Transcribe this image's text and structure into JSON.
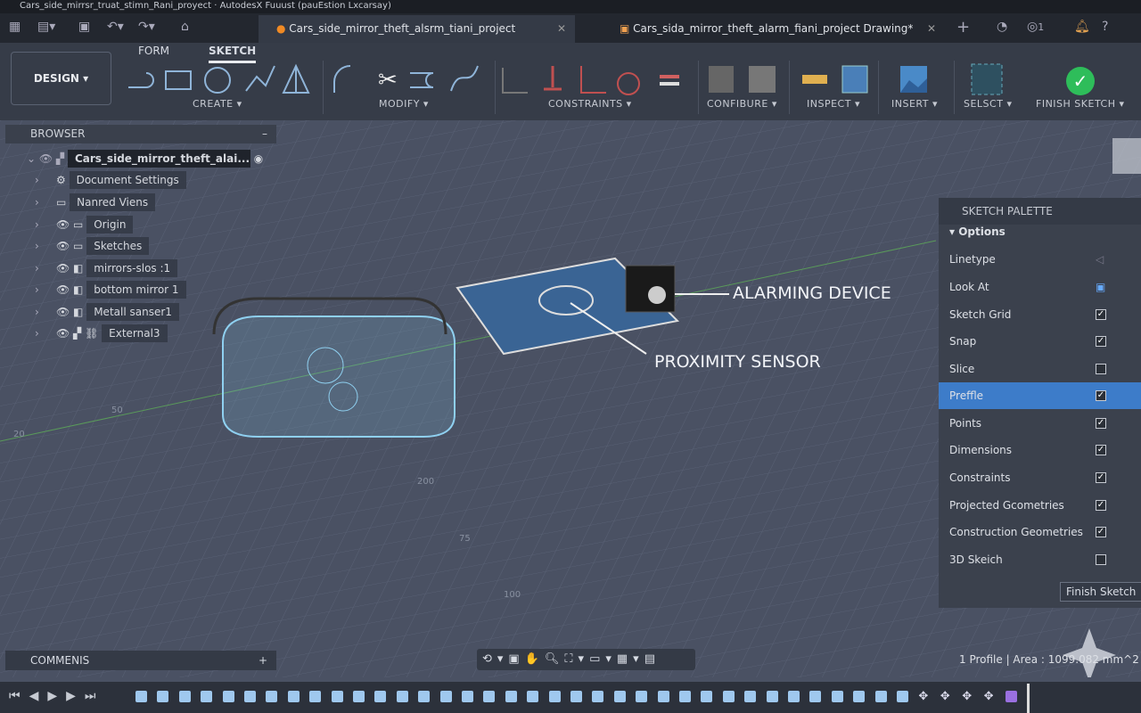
{
  "window": {
    "title": "Cars_side_mirrsr_truat_stimn_Rani_proyect · AutodesX Fuuust (pauEstion Lxcarsay)"
  },
  "tabs": [
    {
      "label": "Cars_side_mirror_theft_alsrm_tiani_project"
    },
    {
      "label": "Cars_sida_mirror_theft_alarm_fiani_project Drawing*"
    }
  ],
  "header_icons": {
    "notifications_count": "1"
  },
  "toolbar": {
    "workspace": "DESIGN",
    "tabs": [
      "FORM",
      "SKETCH"
    ],
    "active_tab": "SKETCH",
    "groups": [
      "CREATE",
      "MODIFY",
      "CONSTRAINTS",
      "CONFIBURE",
      "INSPECT",
      "INSERT",
      "SELSCT",
      "FINISH SKETCH"
    ]
  },
  "browser": {
    "title": "BROWSER",
    "items": [
      {
        "label": "Cars_side_mirror_theft_alai...",
        "icon": "component-icon"
      },
      {
        "label": "Document Settings",
        "icon": "gear-icon"
      },
      {
        "label": "Nanred Viens",
        "icon": "folder-icon"
      },
      {
        "label": "Origin",
        "icon": "folder-icon"
      },
      {
        "label": "Sketches",
        "icon": "folder-icon"
      },
      {
        "label": "mirrors-slos :1",
        "icon": "body-icon"
      },
      {
        "label": "bottom mirror 1",
        "icon": "body-icon"
      },
      {
        "label": "Metall sanser1",
        "icon": "body-icon"
      },
      {
        "label": "External3",
        "icon": "link-icon"
      }
    ]
  },
  "viewport": {
    "callouts": [
      "ALARMING DEVICE",
      "PROXIMITY SENSOR"
    ],
    "grid_labels": [
      "20",
      "50",
      "200",
      "75",
      "100"
    ]
  },
  "palette": {
    "title": "SKETCH PALETTE",
    "section": "Options",
    "rows": [
      {
        "label": "Linetype",
        "type": "icon"
      },
      {
        "label": "Look At",
        "type": "icon"
      },
      {
        "label": "Sketch Grid",
        "checked": true
      },
      {
        "label": "Snap",
        "checked": true
      },
      {
        "label": "Slice",
        "checked": false
      },
      {
        "label": "Preffle",
        "checked": true,
        "highlighted": true
      },
      {
        "label": "Points",
        "checked": true
      },
      {
        "label": "Dimensions",
        "checked": true
      },
      {
        "label": "Constraints",
        "checked": true
      },
      {
        "label": "Projected Gcometries",
        "checked": true
      },
      {
        "label": "Construction Geometries",
        "checked": true
      },
      {
        "label": "3D Skeich",
        "checked": false
      }
    ],
    "finish": "Finish Sketch"
  },
  "comments": {
    "title": "COMMENIS"
  },
  "status": {
    "text": "1 Profile | Area : 1099.082 mm^2"
  },
  "colors": {
    "accent": "#3d7cc9",
    "finish": "#2ebd5a",
    "viewport": "#4a5163"
  }
}
